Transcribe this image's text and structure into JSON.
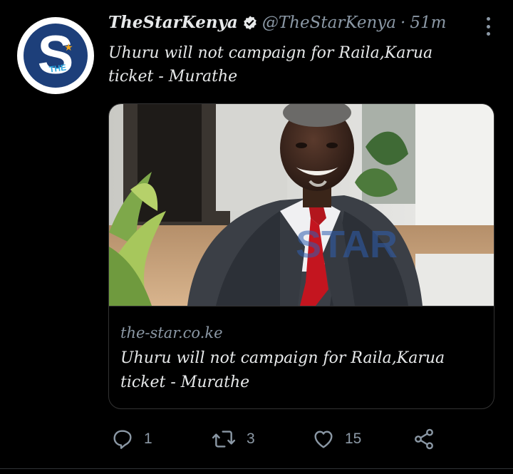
{
  "tweet": {
    "display_name": "TheStarKenya",
    "handle": "@TheStarKenya",
    "separator": "·",
    "time": "51m",
    "text": "Uhuru will not campaign for Raila,Karua ticket - Murathe",
    "avatar": {
      "letter": "S",
      "small_text": "THE",
      "icon": "star-icon"
    }
  },
  "card": {
    "image_watermark": "STAR",
    "domain": "the-star.co.ke",
    "title": "Uhuru will not campaign for Raila,Karua ticket - Murathe"
  },
  "actions": {
    "reply": {
      "icon": "reply-icon",
      "count": "1"
    },
    "retweet": {
      "icon": "retweet-icon",
      "count": "3"
    },
    "like": {
      "icon": "heart-icon",
      "count": "15"
    },
    "share": {
      "icon": "share-icon"
    }
  },
  "colors": {
    "background": "#000000",
    "text": "#e7e9ea",
    "secondary": "#8b98a5",
    "border": "#333333"
  }
}
